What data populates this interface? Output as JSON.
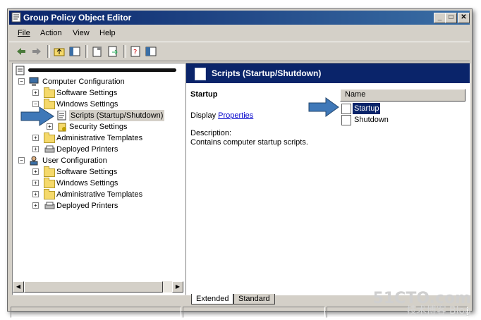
{
  "window": {
    "title": "Group Policy Object Editor"
  },
  "menu": [
    "File",
    "Action",
    "View",
    "Help"
  ],
  "tree": {
    "root_label": "",
    "items": [
      {
        "label": "Computer Configuration",
        "level": 1,
        "expander": "-"
      },
      {
        "label": "Software Settings",
        "level": 2,
        "expander": "+"
      },
      {
        "label": "Windows Settings",
        "level": 2,
        "expander": "-"
      },
      {
        "label": "Scripts (Startup/Shutdown)",
        "level": 3,
        "expander": "",
        "selected": true
      },
      {
        "label": "Security Settings",
        "level": 3,
        "expander": "+"
      },
      {
        "label": "Administrative Templates",
        "level": 2,
        "expander": "+"
      },
      {
        "label": "Deployed Printers",
        "level": 2,
        "expander": "+"
      },
      {
        "label": "User Configuration",
        "level": 1,
        "expander": "-"
      },
      {
        "label": "Software Settings",
        "level": 2,
        "expander": "+"
      },
      {
        "label": "Windows Settings",
        "level": 2,
        "expander": "+"
      },
      {
        "label": "Administrative Templates",
        "level": 2,
        "expander": "+"
      },
      {
        "label": "Deployed Printers",
        "level": 2,
        "expander": "+"
      }
    ]
  },
  "right": {
    "header": "Scripts (Startup/Shutdown)",
    "desc_title": "Startup",
    "display_prefix": "Display",
    "properties_link": "Properties",
    "description_label": "Description:",
    "description_text": "Contains computer startup scripts.",
    "list_column": "Name",
    "list_items": [
      "Startup",
      "Shutdown"
    ]
  },
  "tabs": [
    "Extended",
    "Standard"
  ],
  "watermark": {
    "line1": "51CTO.com",
    "line2": "技术博客 Blog"
  },
  "colors": {
    "title_bar": "#0a246a",
    "highlight_arrow": "#3f78b8",
    "selection": "#0a246a"
  }
}
